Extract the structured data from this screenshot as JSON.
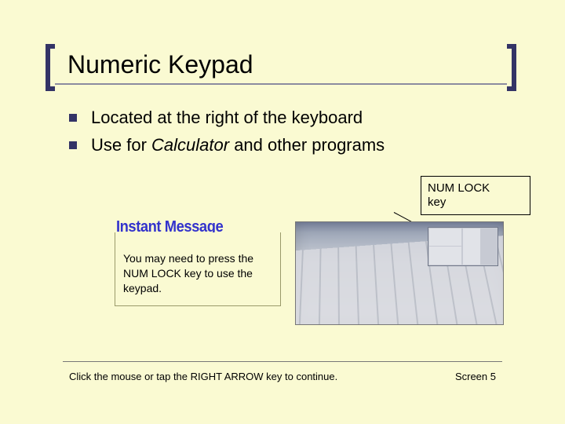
{
  "title": "Numeric Keypad",
  "bullets": [
    {
      "plain": "Located at the right of the keyboard"
    },
    {
      "prefix": "Use for ",
      "italic": "Calculator",
      "suffix": " and other programs"
    }
  ],
  "callout": {
    "line1": "NUM LOCK",
    "line2": "key"
  },
  "instant_message": {
    "header": "Instant Message",
    "body": "You may need to press the NUM LOCK key to use the keypad."
  },
  "footer": {
    "instruction": "Click the mouse or tap the RIGHT ARROW key to continue.",
    "screen_label": "Screen 5"
  },
  "image": {
    "alt": "keyboard-numeric-keypad"
  }
}
